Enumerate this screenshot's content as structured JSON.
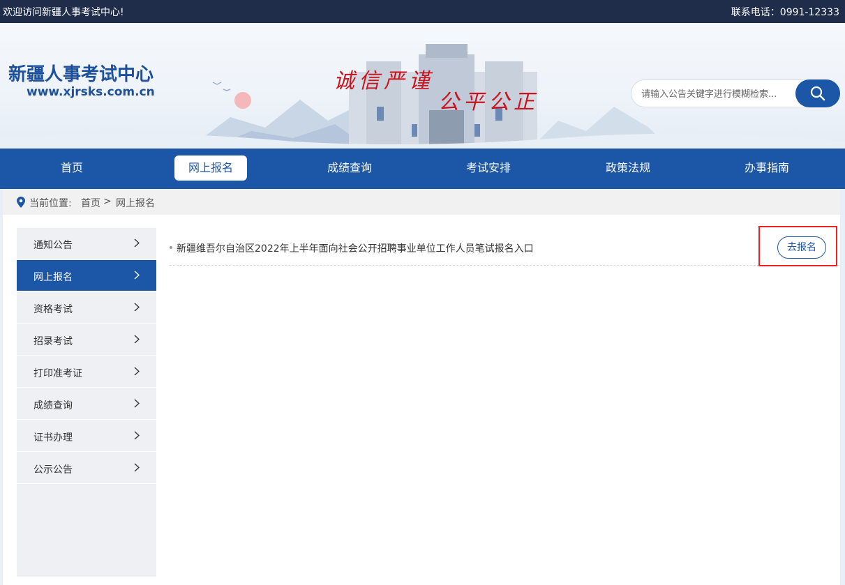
{
  "topbar": {
    "welcome": "欢迎访问新疆人事考试中心!",
    "phone": "联系电话：0991-12333"
  },
  "header": {
    "site_name": "新疆人事考试中心",
    "site_url": "www.xjrsks.com.cn",
    "slogan_left": "诚信严谨",
    "slogan_right": "公平公正"
  },
  "search": {
    "placeholder": "请输入公告关键字进行模糊检索...",
    "button_icon": "search-icon"
  },
  "nav": {
    "items": [
      {
        "label": "首页"
      },
      {
        "label": "网上报名",
        "active": true
      },
      {
        "label": "成绩查询"
      },
      {
        "label": "考试安排"
      },
      {
        "label": "政策法规"
      },
      {
        "label": "办事指南"
      }
    ]
  },
  "breadcrumb": {
    "icon": "location-pin-icon",
    "label": "当前位置:",
    "home": "首页",
    "separator": ">",
    "current": "网上报名"
  },
  "sidebar": {
    "items": [
      {
        "label": "通知公告"
      },
      {
        "label": "网上报名",
        "active": true
      },
      {
        "label": "资格考试"
      },
      {
        "label": "招录考试"
      },
      {
        "label": "打印准考证"
      },
      {
        "label": "成绩查询"
      },
      {
        "label": "证书办理"
      },
      {
        "label": "公示公告"
      }
    ],
    "chevron_icon": "chevron-right-icon"
  },
  "content": {
    "items": [
      {
        "title": "新疆维吾尔自治区2022年上半年面向社会公开招聘事业单位工作人员笔试报名入口",
        "action": "去报名"
      }
    ]
  },
  "colors": {
    "primary": "#1c56a6",
    "topbar": "#1f2d4a",
    "slogan": "#c8151d",
    "highlight": "#ee2222"
  }
}
